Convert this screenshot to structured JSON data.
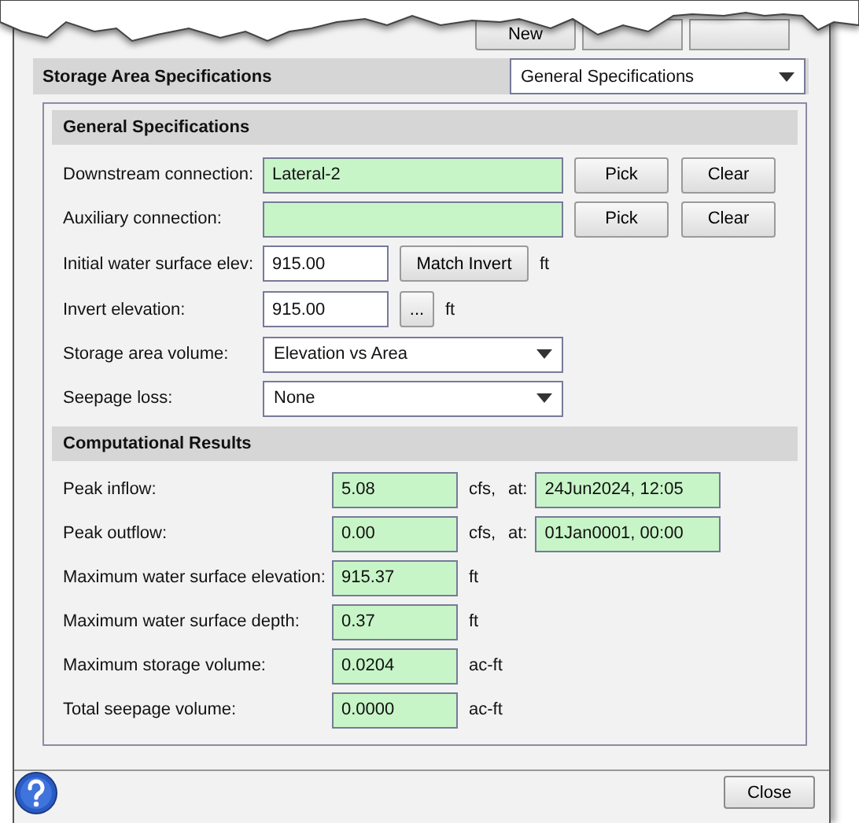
{
  "top_buttons": [
    {
      "label": "New"
    }
  ],
  "header": {
    "title": "Storage Area Specifications",
    "view_select": "General Specifications"
  },
  "general": {
    "title": "General Specifications",
    "rows": [
      {
        "kind": "connection",
        "label": "Downstream connection:",
        "value": "Lateral-2",
        "buttons": [
          "Pick",
          "Clear"
        ]
      },
      {
        "kind": "connection",
        "label": "Auxiliary connection:",
        "buttons": [
          "Pick",
          "Clear"
        ]
      },
      {
        "kind": "input",
        "label": "Initial water surface elev:",
        "value": "915.00",
        "button": "Match Invert",
        "unit": "ft"
      },
      {
        "kind": "input",
        "label": "Invert elevation:",
        "value": "915.00",
        "button": "...",
        "unit": "ft"
      },
      {
        "kind": "select",
        "label": "Storage area volume:",
        "value": "Elevation vs Area"
      },
      {
        "kind": "select",
        "label": "Seepage loss:",
        "value": "None"
      }
    ]
  },
  "results": {
    "title": "Computational Results",
    "rows": [
      {
        "label": "Peak inflow:",
        "value": "5.08",
        "unit": "cfs,",
        "at_label": "at:",
        "at_value": "24Jun2024, 12:05"
      },
      {
        "label": "Peak outflow:",
        "value": "0.00",
        "unit": "cfs,",
        "at_label": "at:",
        "at_value": "01Jan0001, 00:00"
      },
      {
        "label": "Maximum water surface elevation:",
        "value": "915.37",
        "unit": "ft"
      },
      {
        "label": "Maximum water surface depth:",
        "value": "0.37",
        "unit": "ft"
      },
      {
        "label": "Maximum storage volume:",
        "value": "0.0204",
        "unit": "ac-ft"
      },
      {
        "label": "Total seepage volume:",
        "value": "0.0000",
        "unit": "ac-ft"
      }
    ]
  },
  "footer": {
    "close": "Close"
  }
}
